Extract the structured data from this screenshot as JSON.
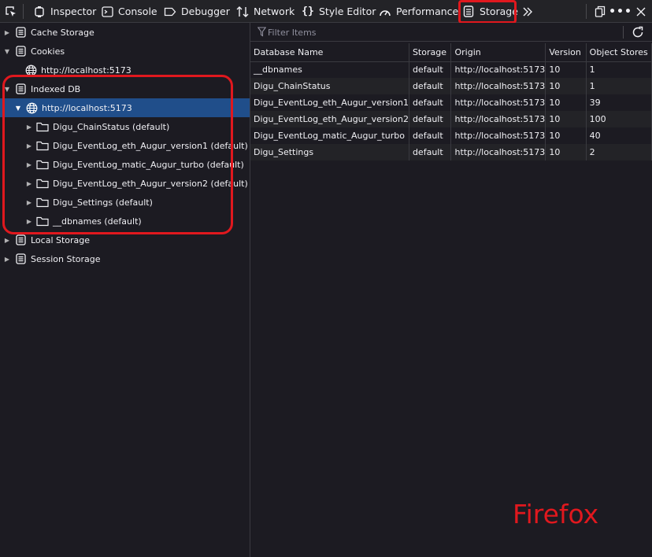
{
  "toolbar": {
    "tabs": [
      {
        "label": "Inspector",
        "icon": "inspector-icon"
      },
      {
        "label": "Console",
        "icon": "console-icon"
      },
      {
        "label": "Debugger",
        "icon": "debugger-icon"
      },
      {
        "label": "Network",
        "icon": "network-icon"
      },
      {
        "label": "Style Editor",
        "icon": "style-editor-icon"
      },
      {
        "label": "Performance",
        "icon": "performance-icon"
      },
      {
        "label": "Storage",
        "icon": "storage-icon",
        "active": true
      }
    ],
    "picker_icon": "element-picker-icon",
    "overflow_icon": "chevrons-right-icon",
    "dock_icon": "dock-side-icon",
    "menu_icon": "more-options-icon",
    "close_icon": "close-icon"
  },
  "sidebar": {
    "items": [
      {
        "label": "Cache Storage",
        "expanded": false
      },
      {
        "label": "Cookies",
        "expanded": true
      },
      {
        "label": "http://localhost:5173"
      },
      {
        "label": "Indexed DB",
        "expanded": true
      },
      {
        "label": "http://localhost:5173",
        "selected": true
      },
      {
        "label": "Digu_ChainStatus (default)"
      },
      {
        "label": "Digu_EventLog_eth_Augur_version1 (default)"
      },
      {
        "label": "Digu_EventLog_matic_Augur_turbo (default)"
      },
      {
        "label": "Digu_EventLog_eth_Augur_version2 (default)"
      },
      {
        "label": "Digu_Settings (default)"
      },
      {
        "label": "__dbnames (default)"
      },
      {
        "label": "Local Storage",
        "expanded": false
      },
      {
        "label": "Session Storage",
        "expanded": false
      }
    ]
  },
  "main": {
    "filter": {
      "placeholder": "Filter Items",
      "value": ""
    },
    "columns": [
      "Database Name",
      "Storage",
      "Origin",
      "Version",
      "Object Stores"
    ],
    "rows": [
      [
        "__dbnames",
        "default",
        "http://localhost:5173",
        "10",
        "1"
      ],
      [
        "Digu_ChainStatus",
        "default",
        "http://localhost:5173",
        "10",
        "1"
      ],
      [
        "Digu_EventLog_eth_Augur_version1",
        "default",
        "http://localhost:5173",
        "10",
        "39"
      ],
      [
        "Digu_EventLog_eth_Augur_version2",
        "default",
        "http://localhost:5173",
        "10",
        "100"
      ],
      [
        "Digu_EventLog_matic_Augur_turbo",
        "default",
        "http://localhost:5173",
        "10",
        "40"
      ],
      [
        "Digu_Settings",
        "default",
        "http://localhost:5173",
        "10",
        "2"
      ]
    ]
  },
  "annotation": {
    "text": "Firefox",
    "color": "#e0181e"
  },
  "colors": {
    "accent": "#0a84ff",
    "highlight": "#e0181e",
    "selection": "#204e8a",
    "background": "#1c1b22"
  }
}
